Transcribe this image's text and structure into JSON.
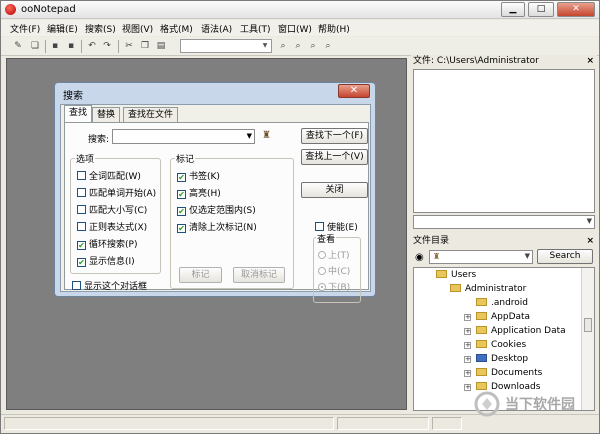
{
  "window": {
    "title": "ooNotepad",
    "minimize": "▁",
    "maximize": "□",
    "close": "✕"
  },
  "menu": [
    "文件(F)",
    "编辑(E)",
    "搜索(S)",
    "视图(V)",
    "格式(M)",
    "语法(A)",
    "工具(T)",
    "窗口(W)",
    "帮助(H)"
  ],
  "right_panel": {
    "title": "文件: C:\\Users\\Administrator",
    "close": "×"
  },
  "tree_panel": {
    "title": "文件目录",
    "close": "×",
    "search_label": "Search",
    "items": [
      {
        "label": "Users",
        "indent": 0
      },
      {
        "label": "Administrator",
        "indent": 1
      },
      {
        "label": ".android",
        "indent": 2
      },
      {
        "label": "AppData",
        "indent": 2
      },
      {
        "label": "Application Data",
        "indent": 2
      },
      {
        "label": "Cookies",
        "indent": 2
      },
      {
        "label": "Desktop",
        "indent": 2
      },
      {
        "label": "Documents",
        "indent": 2
      },
      {
        "label": "Downloads",
        "indent": 2
      }
    ]
  },
  "dialog": {
    "title": "搜索",
    "close": "✕",
    "tabs": [
      "查找",
      "替换",
      "查找在文件"
    ],
    "search_label": "搜索:",
    "search_value": "",
    "buttons": {
      "find_next": "查找下一个(F)",
      "find_prev": "查找上一个(V)",
      "close": "关闭",
      "mark": "标记",
      "unmark": "取消标记"
    },
    "options_title": "选项",
    "options": [
      {
        "label": "全词匹配(W)",
        "checked": false
      },
      {
        "label": "匹配单词开始(A)",
        "checked": false
      },
      {
        "label": "匹配大小写(C)",
        "checked": false
      },
      {
        "label": "正则表达式(X)",
        "checked": false
      },
      {
        "label": "循环搜索(P)",
        "checked": true
      },
      {
        "label": "显示信息(I)",
        "checked": true
      }
    ],
    "mark_title": "标记",
    "marks": [
      {
        "label": "书签(K)",
        "checked": true
      },
      {
        "label": "高亮(H)",
        "checked": true
      },
      {
        "label": "仅选定范围内(S)",
        "checked": true
      },
      {
        "label": "清除上次标记(N)",
        "checked": true
      }
    ],
    "enable_label": "使能(E)",
    "view_title": "查看",
    "view_options": [
      "上(T)",
      "中(C)",
      "下(B)"
    ],
    "show_dialog_label": "显示这个对话框"
  },
  "watermark": "当下软件园",
  "colors": {
    "mdi_bg": "#7f7f7f",
    "dialog_frame": "#c8d7ea",
    "checkmark": "#21a121",
    "close_red": "#c6452f"
  }
}
